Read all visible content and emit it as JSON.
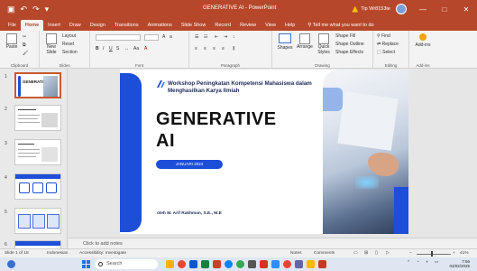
{
  "titlebar": {
    "doc_title": "GENERATIVE AI - PowerPoint",
    "user": "Tip Wr8153te",
    "minimize": "—",
    "maximize": "□",
    "close": "✕"
  },
  "tabs": [
    "File",
    "Home",
    "Insert",
    "Draw",
    "Design",
    "Transitions",
    "Animations",
    "Slide Show",
    "Record",
    "Review",
    "View",
    "Help"
  ],
  "tell_me": "Tell me what you want to do",
  "ribbon": {
    "paste": "Paste",
    "new_slide": "New Slide",
    "layout": "Layout",
    "reset": "Reset",
    "section": "Section",
    "shapes": "Shapes",
    "arrange": "Arrange",
    "quick_styles": "Quick Styles",
    "shape_fill": "Shape Fill",
    "shape_outline": "Shape Outline",
    "shape_effects": "Shape Effects",
    "find": "Find",
    "replace": "Replace",
    "select": "Select",
    "addins": "Add-ins",
    "groups": {
      "clipboard": "Clipboard",
      "slides": "Slides",
      "font": "Font",
      "paragraph": "Paragraph",
      "drawing": "Drawing",
      "editing": "Editing",
      "addins": "Add-ins"
    }
  },
  "thumbnails": {
    "numbers": [
      "1",
      "2",
      "3",
      "4",
      "5",
      "6"
    ],
    "slide1_title": "GENERATIVE AI"
  },
  "slide": {
    "institution": "Workshop Peningkatan Kompetensi Mahasiswa dalam Menghasilkan Karya Ilmiah",
    "title_line1": "GENERATIVE",
    "title_line2": "AI",
    "date": "JANUARI 2024",
    "author": "oleh M. Arif Rakhman, S.E., M.E"
  },
  "notes_placeholder": "Click to add notes",
  "status": {
    "slide_count": "Slide 1 of 18",
    "language": "Indonesian",
    "accessibility": "Accessibility: Investigate",
    "notes": "Notes",
    "comments": "Comments",
    "zoom": "41%"
  },
  "taskbar": {
    "search": "Search",
    "time": "7:56",
    "date": "04/02/2025"
  },
  "colors": {
    "accent": "#b7472a",
    "slide_blue": "#1d4ed8"
  }
}
